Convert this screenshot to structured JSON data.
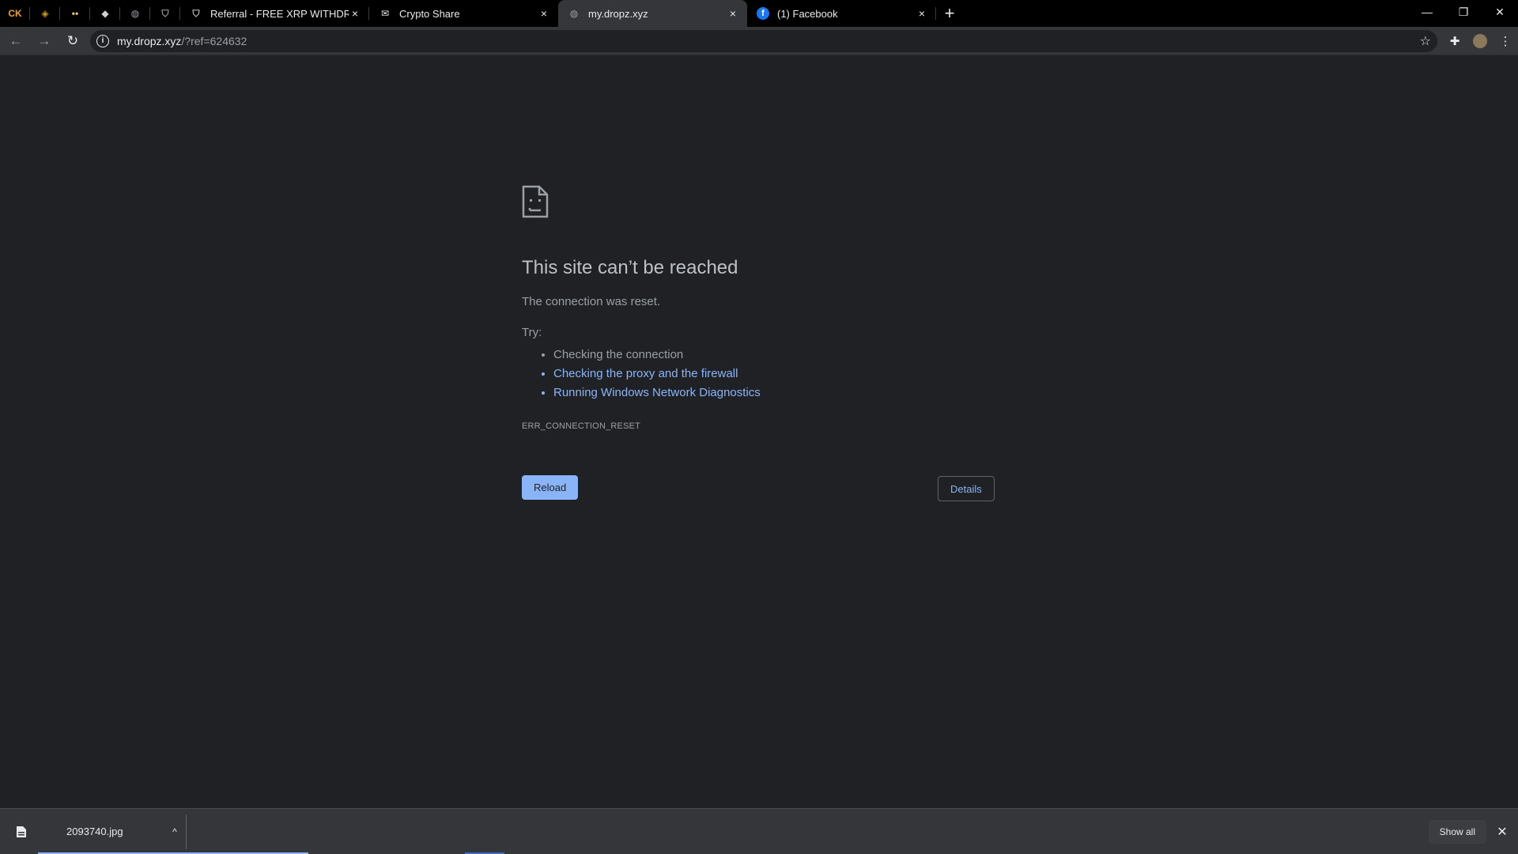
{
  "tabs": {
    "pinned": [
      {
        "icon": "ck-logo-icon",
        "glyph": "CK",
        "color": "#f0a030"
      },
      {
        "icon": "diamond-coin-icon",
        "glyph": "◈",
        "color": "#d4a017"
      },
      {
        "icon": "eyes-icon",
        "glyph": "••",
        "color": "#e0c060"
      },
      {
        "icon": "chat-bubble-icon",
        "glyph": "◆",
        "color": "#d0d0d0"
      },
      {
        "icon": "globe-icon",
        "glyph": "◍",
        "color": "#9aa0a6"
      },
      {
        "icon": "shield-icon",
        "glyph": "⛉",
        "color": "#9aa0a6"
      }
    ],
    "items": [
      {
        "title": "Referral - FREE XRP WITHDRAW",
        "icon": "shield-icon",
        "glyph": "⛉",
        "active": false
      },
      {
        "title": "Crypto Share",
        "icon": "envelope-icon",
        "glyph": "✉",
        "active": false
      },
      {
        "title": "my.dropz.xyz",
        "icon": "globe-icon",
        "glyph": "◍",
        "active": true
      },
      {
        "title": "(1) Facebook",
        "icon": "facebook-icon",
        "glyph": "f",
        "active": false
      }
    ],
    "close_glyph": "×",
    "new_tab_glyph": "+"
  },
  "window": {
    "minimize": "—",
    "restore": "❐",
    "close": "✕"
  },
  "toolbar": {
    "back": "←",
    "forward": "→",
    "reload": "↻",
    "url_host": "my.dropz.xyz",
    "url_path": "/?ref=624632",
    "info_glyph": "i",
    "star_glyph": "☆",
    "extensions_glyph": "✚",
    "menu_glyph": "⋮"
  },
  "error": {
    "title": "This site can’t be reached",
    "message": "The connection was reset.",
    "try_label": "Try:",
    "suggestions": [
      {
        "text": "Checking the connection",
        "link": false
      },
      {
        "text": "Checking the proxy and the firewall",
        "link": true
      },
      {
        "text": "Running Windows Network Diagnostics",
        "link": true
      }
    ],
    "code": "ERR_CONNECTION_RESET",
    "reload_label": "Reload",
    "details_label": "Details"
  },
  "downloads": {
    "file_name": "2093740.jpg",
    "caret": "^",
    "show_all_label": "Show all",
    "close_glyph": "✕"
  }
}
